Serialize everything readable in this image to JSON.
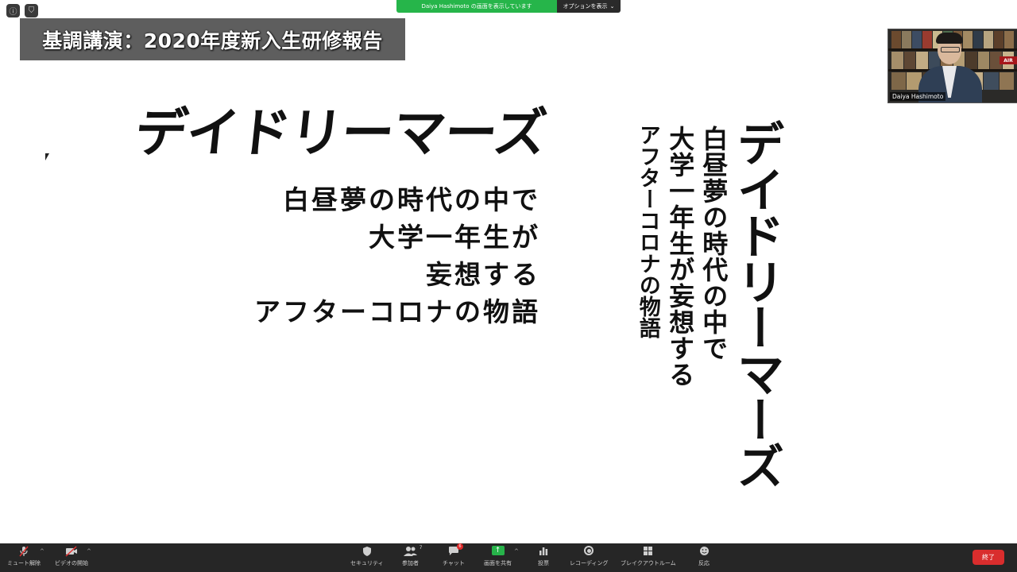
{
  "banner": {
    "sharing_text": "Daiya Hashimoto の画面を表示しています",
    "options_label": "オプションを表示",
    "options_caret": "⌄"
  },
  "caption": {
    "text": "基調講演：2020年度新入生研修報告"
  },
  "video": {
    "participant_name": "Daiya Hashimoto",
    "sign_text": "AIR"
  },
  "slide": {
    "horizontal": {
      "title": "デイドリーマーズ",
      "lines": [
        "白昼夢の時代の中で",
        "大学一年生が",
        "妄想する",
        "アフターコロナの物語"
      ]
    },
    "vertical": {
      "title": "デイドリーマーズ",
      "line1": "白昼夢の時代の中で",
      "line2": "大学一年生が妄想する",
      "line3": "アフターコロナの物語"
    }
  },
  "toolbar": {
    "mute": "ミュート解除",
    "video": "ビデオの開始",
    "security": "セキュリティ",
    "participants": "参加者",
    "participants_count": "7",
    "chat": "チャット",
    "chat_badge": "6",
    "share": "画面を共有",
    "poll": "投票",
    "record": "レコーディング",
    "breakout": "ブレイクアウトルーム",
    "reactions": "反応",
    "end": "終了"
  }
}
